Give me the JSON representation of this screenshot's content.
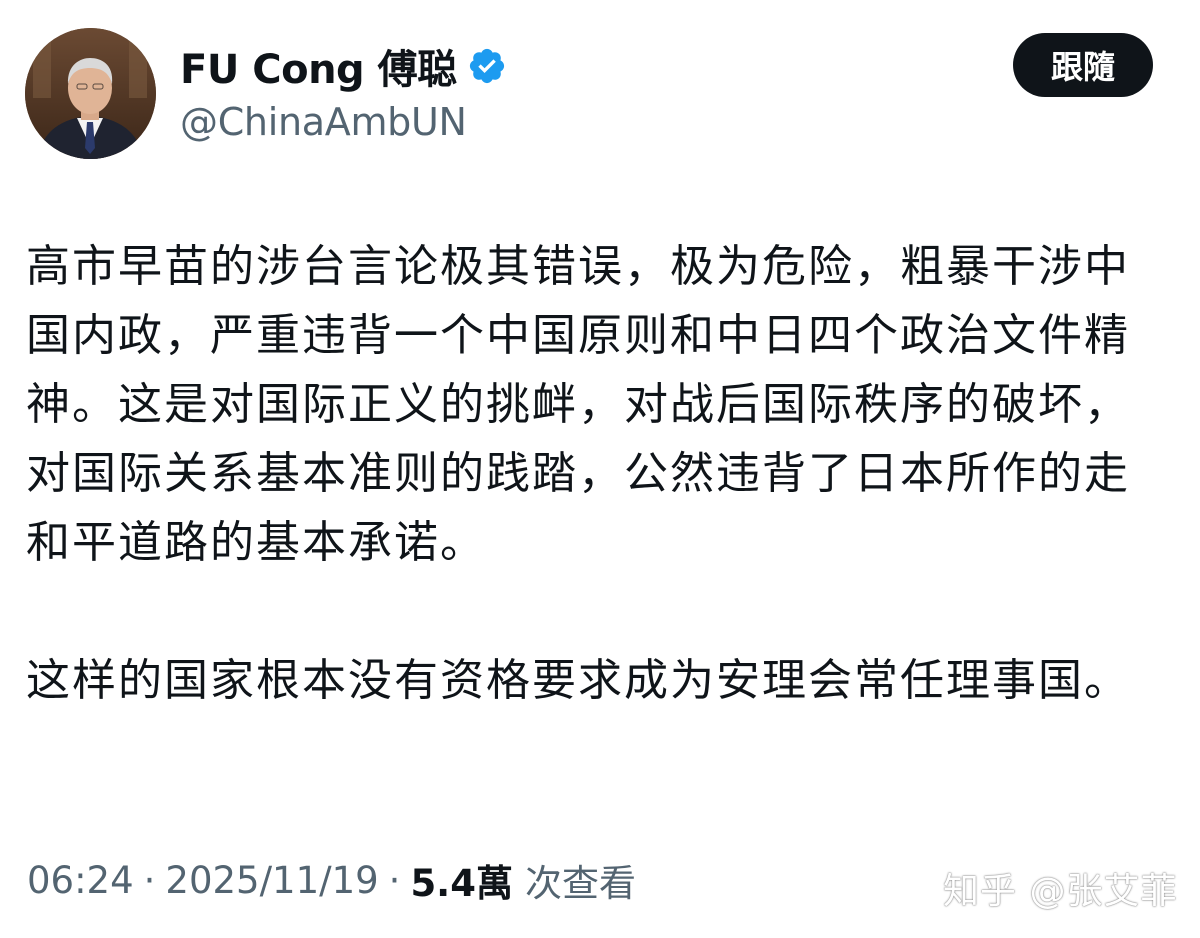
{
  "header": {
    "display_name": "FU Cong 傅聪",
    "handle": "@ChinaAmbUN",
    "follow_label": "跟隨"
  },
  "tweet": {
    "paragraph_1": "高市早苗的涉台言论极其错误，极为危险，粗暴干涉中国内政，严重违背一个中国原则和中日四个政治文件精神。这是对国际正义的挑衅，对战后国际秩序的破坏，对国际关系基本准则的践踏，公然违背了日本所作的走和平道路的基本承诺。",
    "paragraph_2": "这样的国家根本没有资格要求成为安理会常任理事国。"
  },
  "meta": {
    "time": "06:24",
    "separator": "·",
    "date": "2025/11/19",
    "views_count": "5.4萬",
    "views_label": "次查看"
  },
  "watermark": {
    "text": "知乎 @张艾菲"
  },
  "icons": {
    "verified": "verified-badge-icon",
    "verified_color": "#1d9bf0"
  },
  "colors": {
    "text_primary": "#0f1419",
    "text_secondary": "#536471",
    "button_bg": "#0f1419",
    "button_text": "#ffffff"
  }
}
